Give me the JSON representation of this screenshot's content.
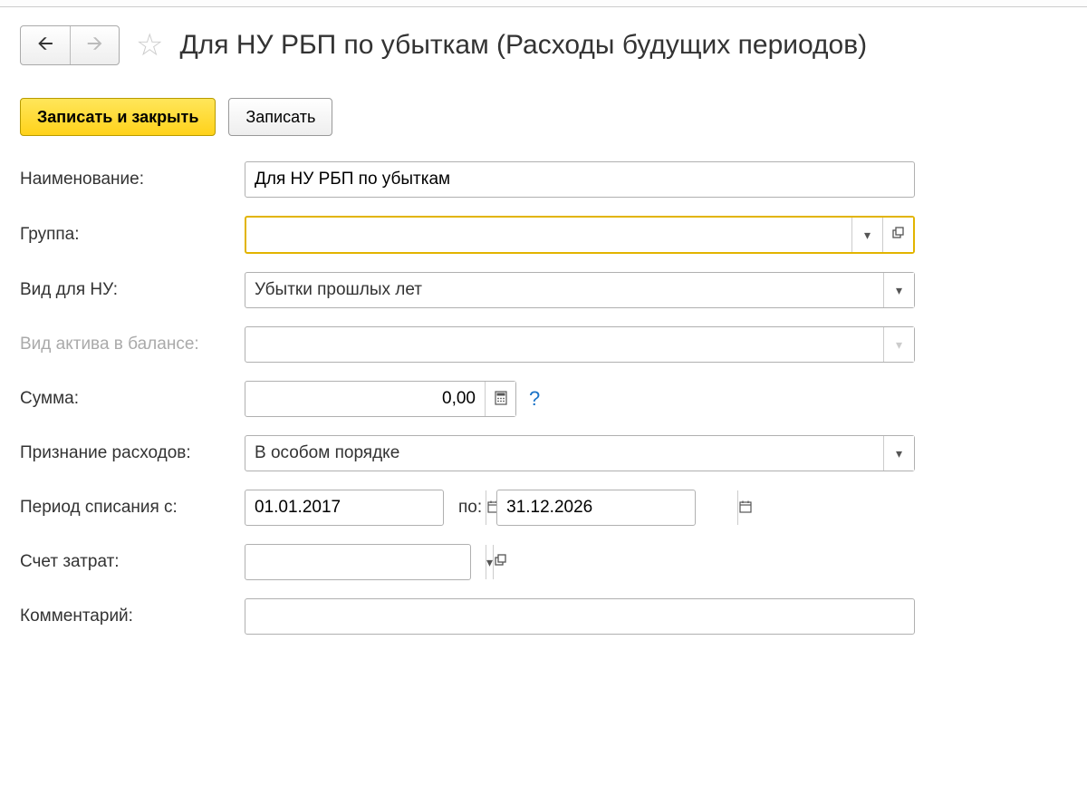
{
  "header": {
    "title": "Для НУ РБП по убыткам (Расходы будущих периодов)"
  },
  "toolbar": {
    "save_close": "Записать и закрыть",
    "save": "Записать"
  },
  "labels": {
    "name": "Наименование:",
    "group": "Группа:",
    "nu_type": "Вид для НУ:",
    "asset_type": "Вид актива в балансе:",
    "sum": "Сумма:",
    "recognition": "Признание расходов:",
    "period_from": "Период списания с:",
    "period_to": "по:",
    "cost_account": "Счет затрат:",
    "comment": "Комментарий:"
  },
  "values": {
    "name": "Для НУ РБП по убыткам",
    "group": "",
    "nu_type": "Убытки прошлых лет",
    "asset_type": "",
    "sum": "0,00",
    "recognition": "В особом порядке",
    "period_from": "01.01.2017",
    "period_to": "31.12.2026",
    "cost_account": "",
    "comment": ""
  },
  "help": "?"
}
